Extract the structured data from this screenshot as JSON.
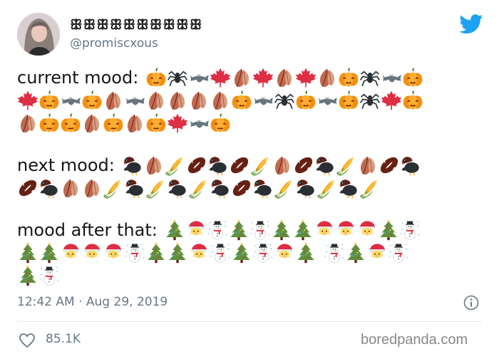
{
  "tweet": {
    "display_name": "ꕥꕥꕥꕥꕥꕥꕥꕥꕥꕥ",
    "handle": "@promiscxous",
    "paragraphs": [
      {
        "label": "current mood:",
        "lines": [
          [
            "pumpkin",
            "spider",
            "bat",
            "maple-leaf",
            "fallen-leaf",
            "maple-leaf",
            "fallen-leaf",
            "maple-leaf",
            "fallen-leaf",
            "pumpkin",
            "spider",
            "bat",
            "pumpkin"
          ],
          [
            "maple-leaf",
            "pumpkin",
            "bat",
            "pumpkin",
            "fallen-leaf",
            "bat",
            "fallen-leaf",
            "fallen-leaf",
            "fallen-leaf",
            "fallen-leaf",
            "pumpkin",
            "bat",
            "spider",
            "pumpkin",
            "bat",
            "pumpkin",
            "spider",
            "maple-leaf",
            "pumpkin"
          ],
          [
            "fallen-leaf",
            "pumpkin",
            "pumpkin",
            "fallen-leaf",
            "pumpkin",
            "fallen-leaf",
            "pumpkin",
            "maple-leaf",
            "bat",
            "pumpkin"
          ]
        ]
      },
      {
        "label": "next mood:",
        "lines": [
          [
            "turkey",
            "fallen-leaf",
            "corn",
            "football",
            "turkey",
            "football",
            "corn",
            "fallen-leaf",
            "football",
            "turkey",
            "corn",
            "fallen-leaf",
            "football",
            "turkey"
          ],
          [
            "football",
            "turkey",
            "fallen-leaf",
            "fallen-leaf",
            "corn",
            "turkey",
            "corn",
            "turkey",
            "corn",
            "turkey",
            "football",
            "turkey",
            "corn",
            "turkey",
            "corn",
            "turkey",
            "corn"
          ]
        ]
      },
      {
        "label": "mood after that:",
        "lines": [
          [
            "tree",
            "santa",
            "snowman",
            "tree",
            "snowman",
            "tree",
            "tree",
            "santa",
            "santa",
            "santa",
            "tree",
            "snowman"
          ],
          [
            "tree",
            "tree",
            "santa",
            "santa",
            "santa",
            "snowman",
            "tree",
            "tree",
            "santa",
            "snowman",
            "tree",
            "snowman",
            "santa",
            "tree",
            "space",
            "snowman",
            "tree",
            "santa",
            "snowman"
          ],
          [
            "tree",
            "snowman"
          ]
        ]
      }
    ],
    "timestamp": "12:42 AM · Aug 29, 2019",
    "likes": "85.1K"
  },
  "watermark": "boredpanda.com",
  "colors": {
    "twitter_blue": "#1da1f2",
    "secondary_text": "#657786",
    "pumpkin": "#f4900c",
    "maple_leaf": "#dd2e44",
    "fallen_leaf": "#c1694f"
  }
}
